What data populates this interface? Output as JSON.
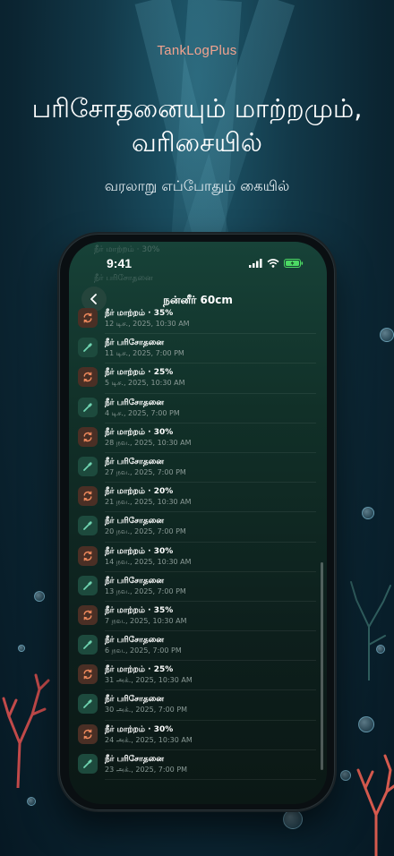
{
  "brand": "TankLogPlus",
  "headline_line1": "பரிசோதனையும் மாற்றமும்,",
  "headline_line2": "வரிசையில்",
  "subtitle": "வரலாறு எப்போதும் கையில்",
  "status": {
    "time": "9:41"
  },
  "ghost_rows": [
    "நீர் மாற்றம் · 30%",
    "நீர் பரிசோதனை"
  ],
  "nav": {
    "title": "நன்னீர் 60cm"
  },
  "log": [
    {
      "kind": "change",
      "title": "நீர் மாற்றம் · 35%",
      "date": "12 டிச., 2025, 10:30 AM"
    },
    {
      "kind": "test",
      "title": "நீர் பரிசோதனை",
      "date": "11 டிச., 2025, 7:00 PM"
    },
    {
      "kind": "change",
      "title": "நீர் மாற்றம் · 25%",
      "date": "5 டிச., 2025, 10:30 AM"
    },
    {
      "kind": "test",
      "title": "நீர் பரிசோதனை",
      "date": "4 டிச., 2025, 7:00 PM"
    },
    {
      "kind": "change",
      "title": "நீர் மாற்றம் · 30%",
      "date": "28 நவ., 2025, 10:30 AM"
    },
    {
      "kind": "test",
      "title": "நீர் பரிசோதனை",
      "date": "27 நவ., 2025, 7:00 PM"
    },
    {
      "kind": "change",
      "title": "நீர் மாற்றம் · 20%",
      "date": "21 நவ., 2025, 10:30 AM"
    },
    {
      "kind": "test",
      "title": "நீர் பரிசோதனை",
      "date": "20 நவ., 2025, 7:00 PM"
    },
    {
      "kind": "change",
      "title": "நீர் மாற்றம் · 30%",
      "date": "14 நவ., 2025, 10:30 AM"
    },
    {
      "kind": "test",
      "title": "நீர் பரிசோதனை",
      "date": "13 நவ., 2025, 7:00 PM"
    },
    {
      "kind": "change",
      "title": "நீர் மாற்றம் · 35%",
      "date": "7 நவ., 2025, 10:30 AM"
    },
    {
      "kind": "test",
      "title": "நீர் பரிசோதனை",
      "date": "6 நவ., 2025, 7:00 PM"
    },
    {
      "kind": "change",
      "title": "நீர் மாற்றம் · 25%",
      "date": "31 அக்., 2025, 10:30 AM"
    },
    {
      "kind": "test",
      "title": "நீர் பரிசோதனை",
      "date": "30 அக்., 2025, 7:00 PM"
    },
    {
      "kind": "change",
      "title": "நீர் மாற்றம் · 30%",
      "date": "24 அக்., 2025, 10:30 AM"
    },
    {
      "kind": "test",
      "title": "நீர் பரிசோதனை",
      "date": "23 அக்., 2025, 7:00 PM"
    }
  ],
  "colors": {
    "brand": "#f2a38f",
    "test_icon_bg": "#1d4a3d",
    "test_icon": "#6fd3b0",
    "change_icon_bg": "#4a2f25",
    "change_icon": "#f08a5d",
    "battery": "#4cd964"
  },
  "icons": {
    "test": "eyedropper-icon",
    "change": "refresh-cycle-icon",
    "back": "chevron-left-icon"
  }
}
